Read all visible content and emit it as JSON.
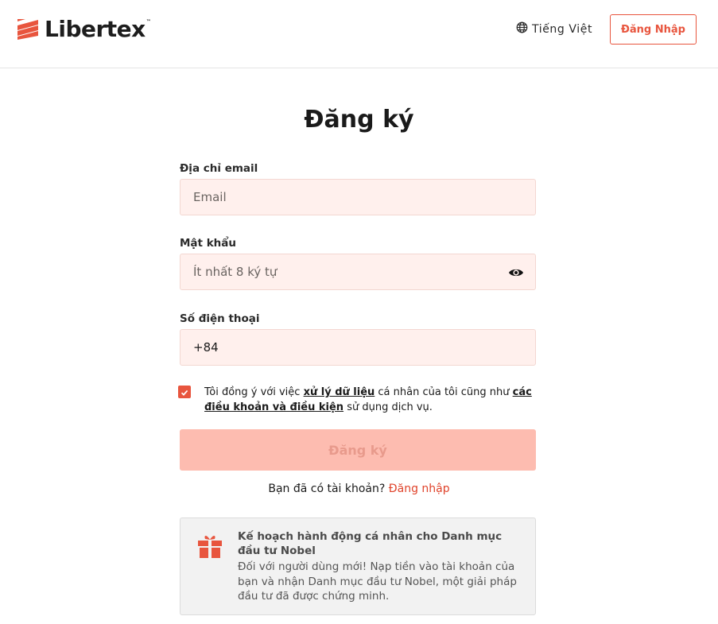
{
  "header": {
    "brand": "Libertex",
    "brand_tm": "™",
    "language_icon": "globe-icon",
    "language_label": "Tiếng Việt",
    "login_label": "Đăng Nhập",
    "accent_color": "#e8553e"
  },
  "form": {
    "title": "Đăng ký",
    "email": {
      "label": "Địa chỉ email",
      "placeholder": "Email",
      "value": ""
    },
    "password": {
      "label": "Mật khẩu",
      "placeholder": "Ít nhất 8 ký tự",
      "value": "",
      "toggle_icon": "eye-icon"
    },
    "phone": {
      "label": "Số điện thoại",
      "value": "+84"
    },
    "consent": {
      "checked": true,
      "text_1": "Tôi đồng ý với việc ",
      "link_1": "xử lý dữ liệu",
      "text_2": " cá nhân của tôi cũng như ",
      "link_2": "các điều khoản và điều kiện",
      "text_3": " sử dụng dịch vụ."
    },
    "submit_label": "Đăng ký",
    "have_account_text": "Bạn đã có tài khoản? ",
    "have_account_link": "Đăng nhập"
  },
  "promo": {
    "icon": "gift-icon",
    "title": "Kế hoạch hành động cá nhân cho Danh mục đầu tư Nobel",
    "body": "Đối với người dùng mới! Nạp tiền vào tài khoản của bạn và nhận Danh mục đầu tư Nobel, một giải pháp đầu tư đã được chứng minh."
  }
}
